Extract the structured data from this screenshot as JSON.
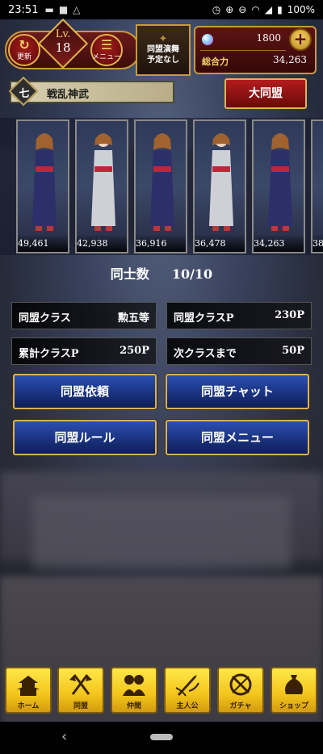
{
  "status_bar": {
    "time": "23:51",
    "battery": "100%",
    "left_icons": [
      "bed-icon",
      "video-icon",
      "drive-icon"
    ],
    "right_icons": [
      "alarm-icon",
      "sync-icon",
      "dnd-icon",
      "wifi-icon",
      "signal-icon",
      "battery-icon"
    ]
  },
  "header": {
    "refresh_label": "更新",
    "level_label": "Lv.",
    "level_value": "18",
    "menu_label": "メニュー",
    "event_lines": [
      "同盟演舞",
      "予定なし"
    ],
    "gems": "1800",
    "power_label": "総合力",
    "power_value": "34,263"
  },
  "alliance": {
    "rank_glyph": "七",
    "name": "戦乱神武",
    "big_alliance_button": "大同盟"
  },
  "members": [
    {
      "power": "49,461",
      "outfit": "navy"
    },
    {
      "power": "42,938",
      "outfit": "white"
    },
    {
      "power": "36,916",
      "outfit": "navy"
    },
    {
      "power": "36,478",
      "outfit": "white"
    },
    {
      "power": "34,263",
      "outfit": "navy"
    },
    {
      "power": "38",
      "outfit": "white"
    }
  ],
  "member_count": {
    "label": "同士数",
    "value": "10/10"
  },
  "info": {
    "class_label": "同盟クラス",
    "class_value": "勲五等",
    "class_points_label": "同盟クラスP",
    "class_points_value": "230P",
    "total_points_label": "累計クラスP",
    "total_points_value": "250P",
    "next_class_label": "次クラスまで",
    "next_class_value": "50P"
  },
  "buttons": {
    "request": "同盟依頼",
    "chat": "同盟チャット",
    "rules": "同盟ルール",
    "menu": "同盟メニュー"
  },
  "nav": [
    {
      "label": "ホーム",
      "icon": "castle-icon"
    },
    {
      "label": "同盟",
      "icon": "crossed-flags-icon"
    },
    {
      "label": "仲間",
      "icon": "people-icon"
    },
    {
      "label": "主人公",
      "icon": "sword-icon"
    },
    {
      "label": "ガチャ",
      "icon": "gacha-icon"
    },
    {
      "label": "ショップ",
      "icon": "money-bag-icon"
    }
  ],
  "colors": {
    "gold": "#e0b44c",
    "crimson": "#8a1414",
    "royal_blue": "#1a3380",
    "nav_yellow": "#f3c51b"
  }
}
